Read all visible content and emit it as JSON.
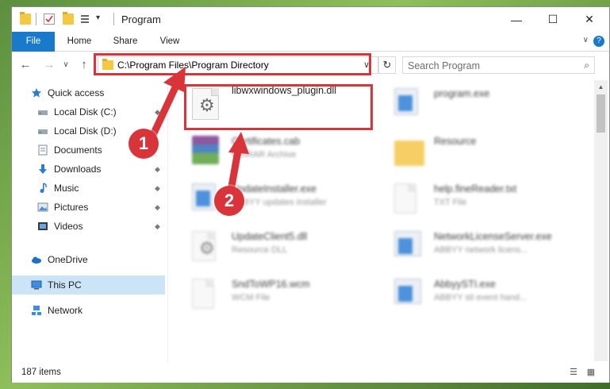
{
  "window": {
    "title": "Program",
    "minimize_glyph": "—",
    "maximize_glyph": "☐",
    "close_glyph": "✕",
    "qat_dropdown_glyph": "▾"
  },
  "ribbon": {
    "tabs": [
      {
        "label": "File"
      },
      {
        "label": "Home"
      },
      {
        "label": "Share"
      },
      {
        "label": "View"
      }
    ],
    "expand_glyph": "∨",
    "help_glyph": "?"
  },
  "nav": {
    "back_glyph": "←",
    "forward_glyph": "→",
    "recent_glyph": "∨",
    "up_glyph": "↑",
    "address_path": "C:\\Program Files\\Program Directory",
    "address_dropdown_glyph": "∨",
    "refresh_glyph": "↻",
    "search_placeholder": "Search Program",
    "search_glyph": "⌕"
  },
  "sidebar": {
    "items": [
      {
        "label": "Quick access",
        "icon": "star-icon",
        "pinned": false
      },
      {
        "label": "Local Disk (C:)",
        "icon": "drive-icon",
        "pinned": true
      },
      {
        "label": "Local Disk (D:)",
        "icon": "drive-icon",
        "pinned": true
      },
      {
        "label": "Documents",
        "icon": "documents-icon",
        "pinned": true
      },
      {
        "label": "Downloads",
        "icon": "download-icon",
        "pinned": true
      },
      {
        "label": "Music",
        "icon": "music-icon",
        "pinned": true
      },
      {
        "label": "Pictures",
        "icon": "pictures-icon",
        "pinned": true
      },
      {
        "label": "Videos",
        "icon": "videos-icon",
        "pinned": true
      },
      {
        "label": "OneDrive",
        "icon": "cloud-icon",
        "pinned": false
      },
      {
        "label": "This PC",
        "icon": "computer-icon",
        "pinned": false,
        "selected": true
      },
      {
        "label": "Network",
        "icon": "network-icon",
        "pinned": false
      }
    ],
    "pin_glyph": "📌"
  },
  "files": [
    {
      "name": "libwxwindows_plugin.dll",
      "type": "",
      "icon": "dll-gear-icon",
      "blurred": false
    },
    {
      "name": "program.exe",
      "type": "",
      "icon": "exe-app-icon",
      "blurred": true
    },
    {
      "name": "Certificates.cab",
      "type": "WinRAR Archive",
      "icon": "rar-archive-icon",
      "blurred": true
    },
    {
      "name": "Resource",
      "type": "",
      "icon": "folder-icon",
      "blurred": true
    },
    {
      "name": "UpdateInstaller.exe",
      "type": "ABBYY updates installer",
      "icon": "exe-app-icon",
      "blurred": true
    },
    {
      "name": "help.fineReader.txt",
      "type": "TXT File",
      "icon": "text-file-icon",
      "blurred": true
    },
    {
      "name": "UpdateClient5.dll",
      "type": "Resource DLL",
      "icon": "dll-gear-icon",
      "blurred": true
    },
    {
      "name": "NetworkLicenseServer.exe",
      "type": "ABBYY network licens...",
      "icon": "exe-app-icon",
      "blurred": true
    },
    {
      "name": "SndToWP16.wcm",
      "type": "WCM File",
      "icon": "text-file-icon",
      "blurred": true
    },
    {
      "name": "AbbyySTI.exe",
      "type": "ABBYY sti event hand...",
      "icon": "exe-app-icon",
      "blurred": true
    }
  ],
  "status": {
    "item_count": "187 items",
    "details_view_glyph": "☰",
    "tiles_view_glyph": "▦"
  },
  "annotations": {
    "markers": [
      {
        "label": "1"
      },
      {
        "label": "2"
      }
    ],
    "color": "#d9343a"
  },
  "colors": {
    "accent": "#1979ca",
    "selection": "#cce4f7",
    "annotation_red": "#d9343a"
  }
}
